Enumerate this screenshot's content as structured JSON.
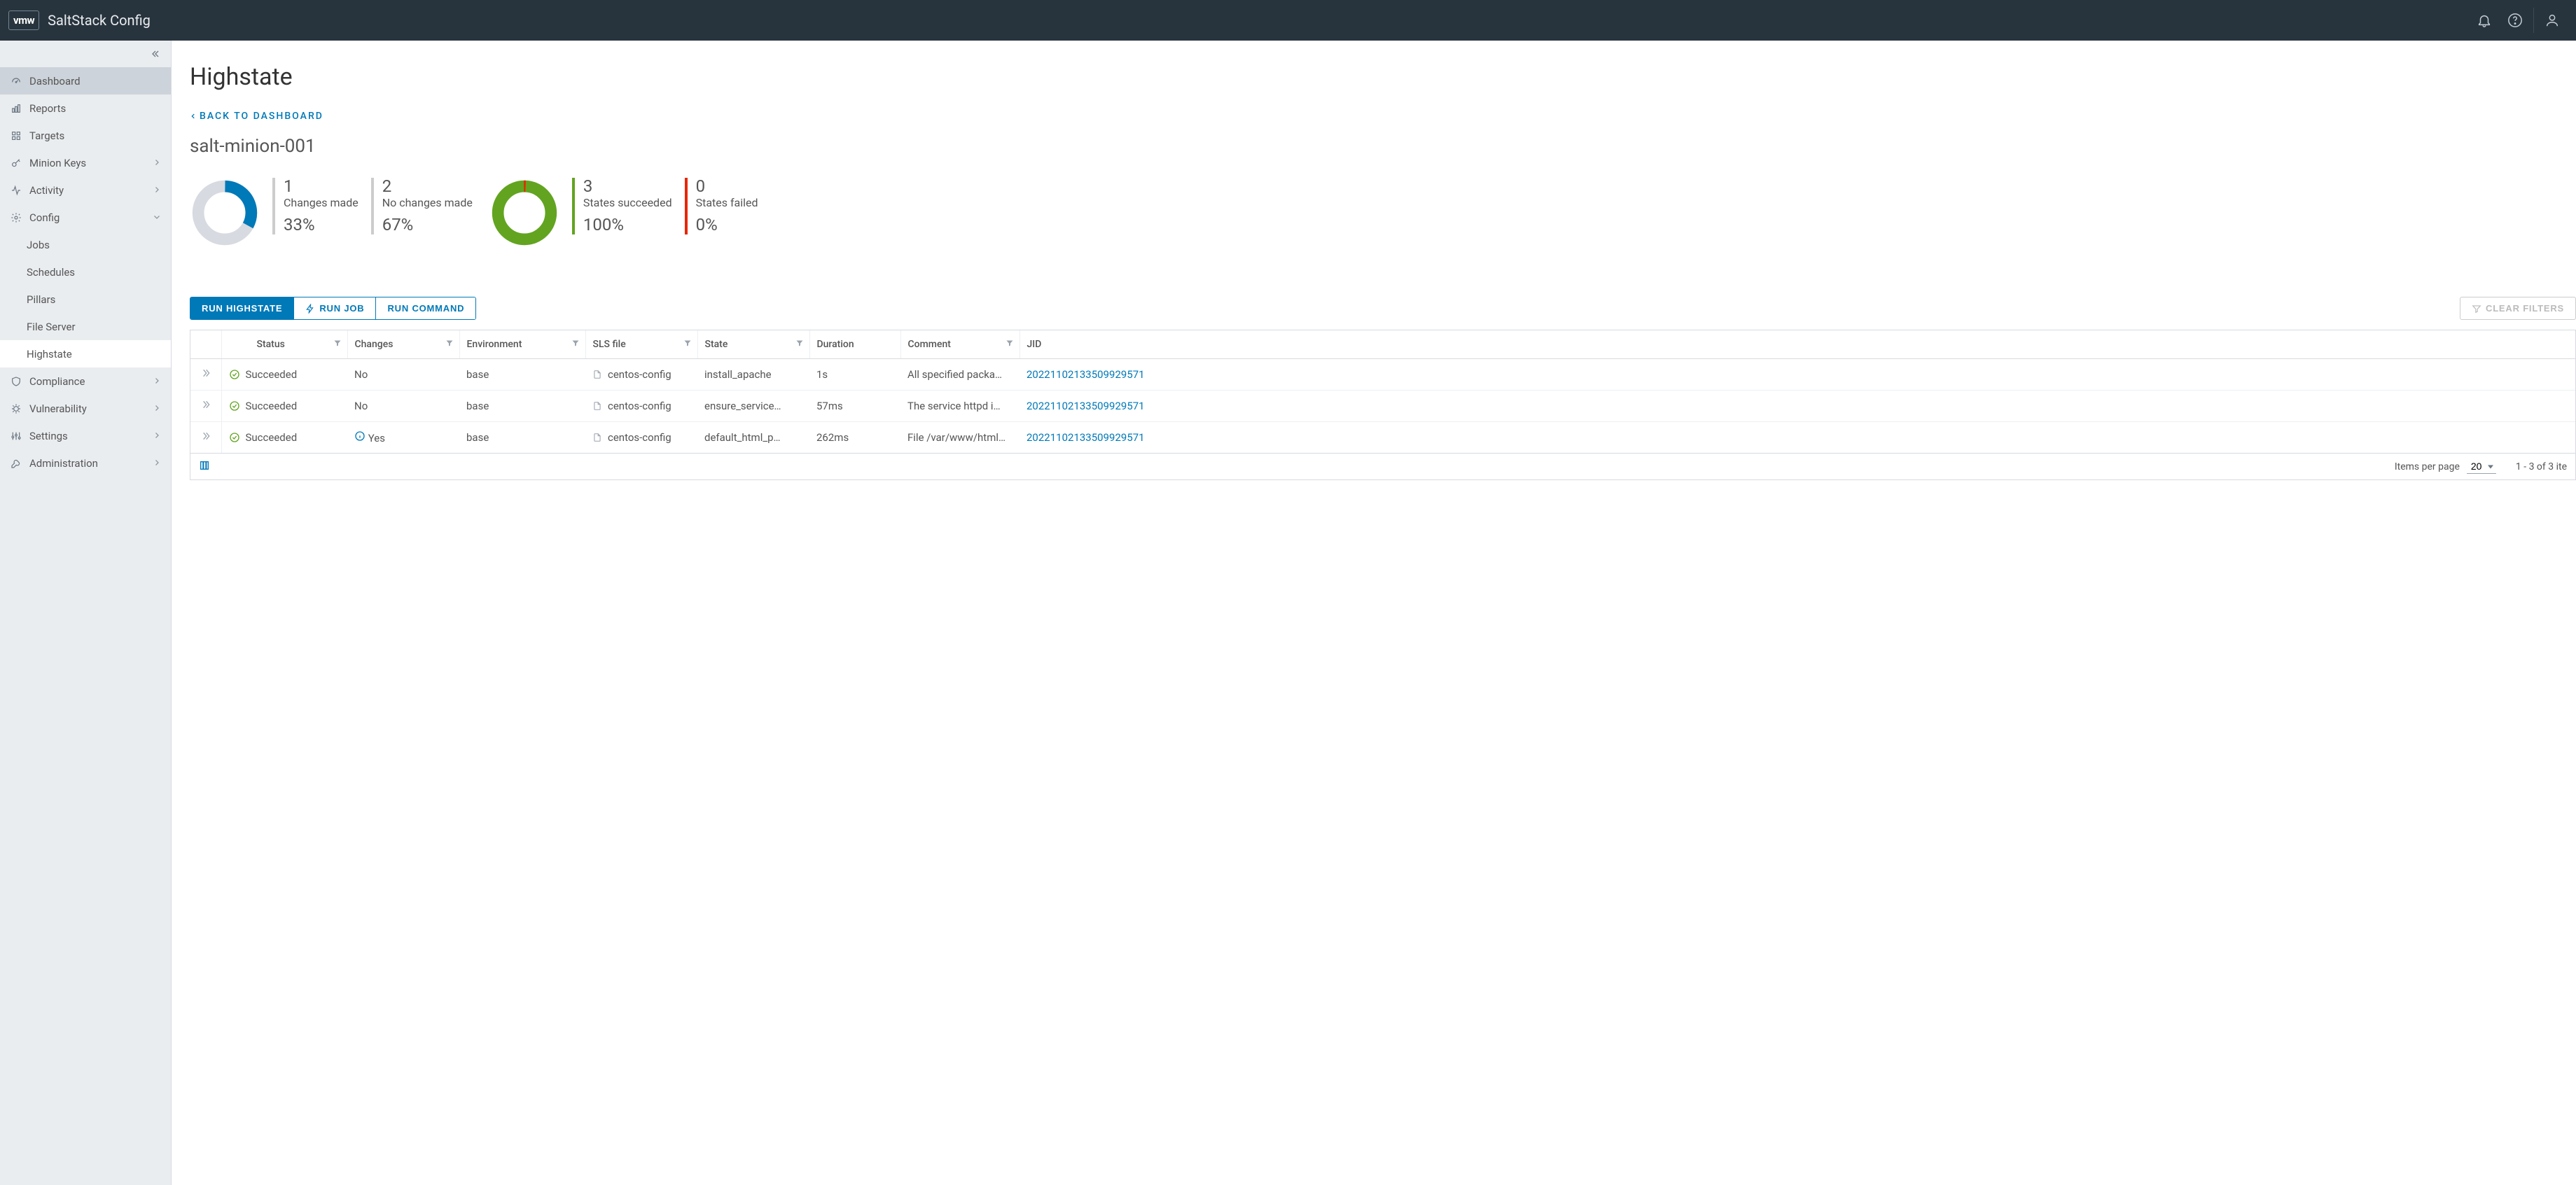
{
  "brand": {
    "logo": "vmw",
    "product": "SaltStack Config"
  },
  "sidebar": {
    "items": [
      {
        "id": "dashboard",
        "label": "Dashboard"
      },
      {
        "id": "reports",
        "label": "Reports"
      },
      {
        "id": "targets",
        "label": "Targets"
      },
      {
        "id": "minion-keys",
        "label": "Minion Keys"
      },
      {
        "id": "activity",
        "label": "Activity"
      },
      {
        "id": "config",
        "label": "Config"
      },
      {
        "id": "compliance",
        "label": "Compliance"
      },
      {
        "id": "vulnerability",
        "label": "Vulnerability"
      },
      {
        "id": "settings",
        "label": "Settings"
      },
      {
        "id": "administration",
        "label": "Administration"
      }
    ],
    "config_children": [
      {
        "id": "jobs",
        "label": "Jobs"
      },
      {
        "id": "schedules",
        "label": "Schedules"
      },
      {
        "id": "pillars",
        "label": "Pillars"
      },
      {
        "id": "file-server",
        "label": "File Server"
      },
      {
        "id": "highstate",
        "label": "Highstate"
      }
    ]
  },
  "page": {
    "title": "Highstate",
    "back": "BACK TO DASHBOARD",
    "subtitle": "salt-minion-001"
  },
  "chart_data": [
    {
      "type": "pie",
      "title": "Changes",
      "series": [
        {
          "name": "Changes made",
          "value": 1,
          "pct": "33%",
          "color": "#0079b8"
        },
        {
          "name": "No changes made",
          "value": 2,
          "pct": "67%",
          "color": "#cccccc"
        }
      ]
    },
    {
      "type": "pie",
      "title": "States",
      "series": [
        {
          "name": "States succeeded",
          "value": 3,
          "pct": "100%",
          "color": "#62a420"
        },
        {
          "name": "States failed",
          "value": 0,
          "pct": "0%",
          "color": "#e62700"
        }
      ]
    }
  ],
  "stats": {
    "changes_made": {
      "num": "1",
      "label": "Changes made",
      "pct": "33%"
    },
    "no_changes": {
      "num": "2",
      "label": "No changes made",
      "pct": "67%"
    },
    "succeeded": {
      "num": "3",
      "label": "States succeeded",
      "pct": "100%"
    },
    "failed": {
      "num": "0",
      "label": "States failed",
      "pct": "0%"
    }
  },
  "actions": {
    "run_highstate": "RUN HIGHSTATE",
    "run_job": "RUN JOB",
    "run_command": "RUN COMMAND",
    "clear_filters": "CLEAR FILTERS"
  },
  "table": {
    "headers": {
      "status": "Status",
      "changes": "Changes",
      "environment": "Environment",
      "sls": "SLS file",
      "state": "State",
      "duration": "Duration",
      "comment": "Comment",
      "jid": "JID"
    },
    "rows": [
      {
        "status": "Succeeded",
        "changes": "No",
        "changes_info": false,
        "environment": "base",
        "sls": "centos-config",
        "state": "install_apache",
        "duration": "1s",
        "comment": "All specified packa…",
        "jid": "20221102133509929571"
      },
      {
        "status": "Succeeded",
        "changes": "No",
        "changes_info": false,
        "environment": "base",
        "sls": "centos-config",
        "state": "ensure_service…",
        "duration": "57ms",
        "comment": "The service httpd i…",
        "jid": "20221102133509929571"
      },
      {
        "status": "Succeeded",
        "changes": "Yes",
        "changes_info": true,
        "environment": "base",
        "sls": "centos-config",
        "state": "default_html_p…",
        "duration": "262ms",
        "comment": "File /var/www/html…",
        "jid": "20221102133509929571"
      }
    ],
    "footer": {
      "items_per_page_label": "Items per page",
      "items_per_page_value": "20",
      "range": "1 - 3 of 3 ite"
    }
  }
}
